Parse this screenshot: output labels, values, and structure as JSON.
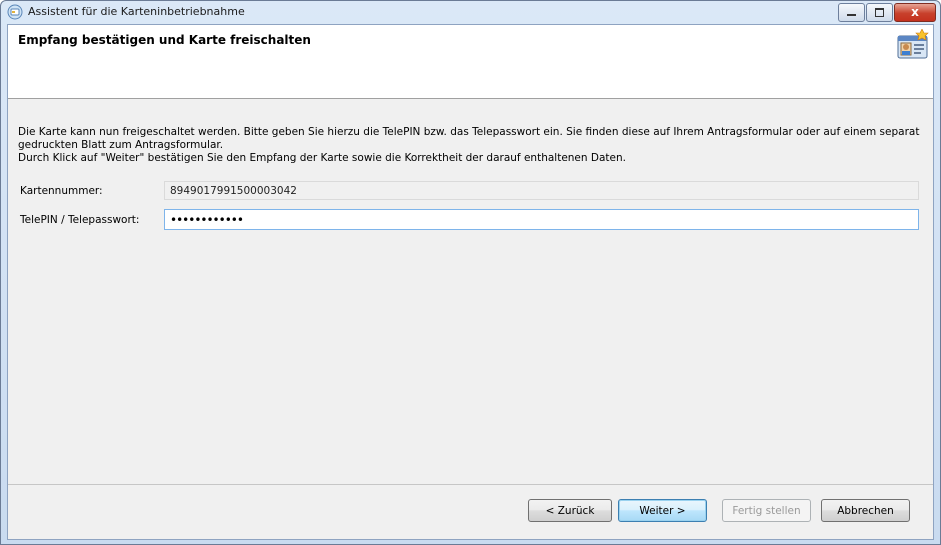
{
  "window": {
    "title": "Assistent für die Karteninbetriebnahme",
    "close_glyph": "x"
  },
  "header": {
    "title": "Empfang bestätigen und Karte freischalten",
    "icon": "id-card-icon"
  },
  "content": {
    "description_line1": "Die Karte kann nun freigeschaltet werden. Bitte geben Sie hierzu die TelePIN bzw. das Telepasswort ein. Sie finden diese auf Ihrem Antragsformular oder auf einem separat gedruckten Blatt zum Antragsformular.",
    "description_line2": "Durch Klick auf \"Weiter\" bestätigen Sie den Empfang der Karte sowie die Korrektheit der darauf enthaltenen Daten.",
    "card_number_label": "Kartennummer:",
    "card_number_value": "8949017991500003042",
    "pin_label": "TelePIN / Telepasswort:",
    "pin_value": "••••••••••••"
  },
  "footer": {
    "back_label": "< Zurück",
    "next_label": "Weiter >",
    "finish_label": "Fertig stellen",
    "cancel_label": "Abbrechen"
  }
}
